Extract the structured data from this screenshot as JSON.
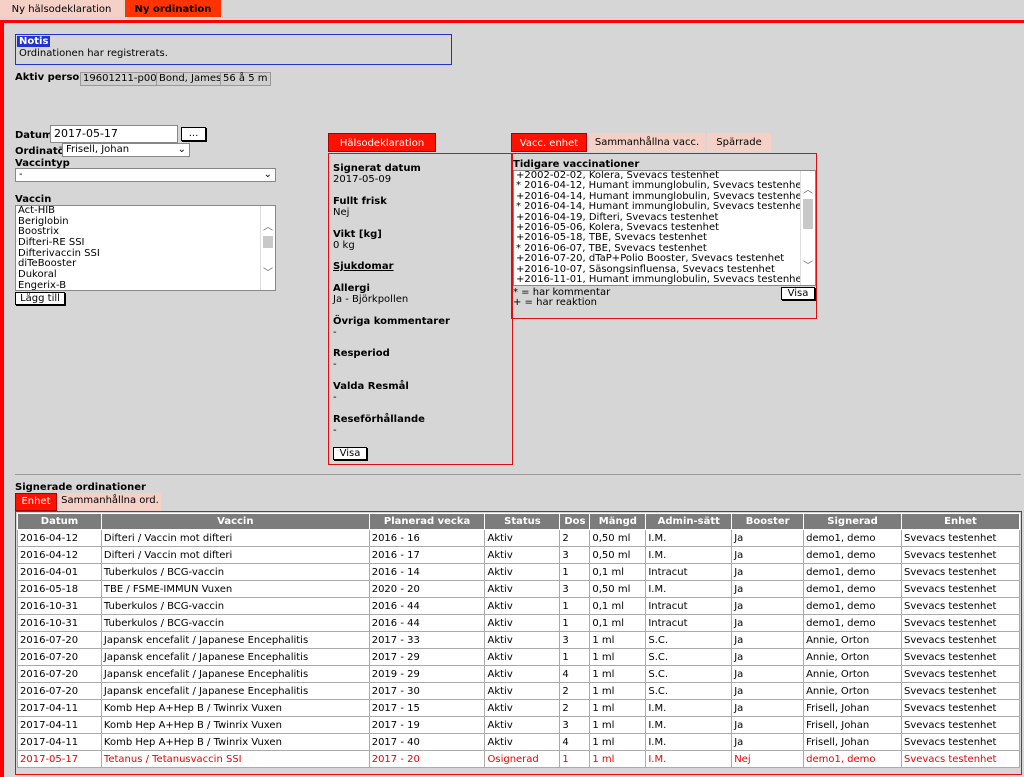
{
  "tabs": {
    "health": "Ny hälsodeklaration",
    "new_order": "Ny ordination"
  },
  "notice": {
    "title": "Notis",
    "message": "Ordinationen har registrerats."
  },
  "active_person": {
    "label": "Aktiv person",
    "id": "19601211-p007",
    "name": "Bond, James",
    "age": "56 å 5 m"
  },
  "form": {
    "date_label": "Datum",
    "date_value": "2017-05-17",
    "date_button": "...",
    "ordinator_label": "Ordinatör",
    "ordinator_value": "Frisell, Johan",
    "vaccintype_label": "Vaccintyp",
    "vaccintype_value": "-",
    "vaccin_label": "Vaccin",
    "vaccines": [
      "Act-HIB",
      "Beriglobin",
      "Boostrix",
      "Difteri-RE SSI",
      "Difterivaccin SSI",
      "diTeBooster",
      "Dukoral",
      "Engerix-B"
    ],
    "add_button": "Lägg till"
  },
  "health": {
    "tab_label": "Hälsodeklaration",
    "signed_label": "Signerat datum",
    "signed_value": "2017-05-09",
    "healthy_label": "Fullt frisk",
    "healthy_value": "Nej",
    "weight_label": "Vikt [kg]",
    "weight_value": "0 kg",
    "diseases_label": "Sjukdomar",
    "allergy_label": "Allergi",
    "allergy_value": "Ja - Björkpollen",
    "comments_label": "Övriga kommentarer",
    "comments_value": "-",
    "travel_period_label": "Resperiod",
    "travel_period_value": "-",
    "destinations_label": "Valda Resmål",
    "destinations_value": "-",
    "conditions_label": "Reseförhållande",
    "conditions_value": "-",
    "show_button": "Visa"
  },
  "vacc": {
    "tabs": [
      "Vacc. enhet",
      "Sammanhållna vacc.",
      "Spärrade"
    ],
    "previous_label": "Tidigare vaccinationer",
    "previous": [
      "+2002-02-02, Kolera, Svevacs testenhet",
      "* 2016-04-12, Humant immunglobulin, Svevacs testenhet",
      "+2016-04-14, Humant immunglobulin, Svevacs testenhet",
      "* 2016-04-14, Humant immunglobulin, Svevacs testenhet",
      "+2016-04-19, Difteri, Svevacs testenhet",
      "+2016-05-06, Kolera, Svevacs testenhet",
      "+2016-05-18, TBE, Svevacs testenhet",
      "* 2016-06-07, TBE, Svevacs testenhet",
      "+2016-07-20, dTaP+Polio Booster, Svevacs testenhet",
      "+2016-10-07, Säsongsinfluensa, Svevacs testenhet",
      "+2016-11-01, Humant immunglobulin, Svevacs testenhet"
    ],
    "legend_comment": "* = har kommentar",
    "legend_reaction": "+ = har reaktion",
    "show_button": "Visa"
  },
  "signed": {
    "title": "Signerade ordinationer",
    "tabs": [
      "Enhet",
      "Sammanhållna ord."
    ],
    "columns": [
      "Datum",
      "Vaccin",
      "Planerad vecka",
      "Status",
      "Dos",
      "Mängd",
      "Admin-sätt",
      "Booster",
      "Signerad",
      "Enhet"
    ],
    "rows": [
      [
        "2016-04-12",
        "Difteri / Vaccin mot difteri",
        "2016 - 16",
        "Aktiv",
        "2",
        "0,50 ml",
        "I.M.",
        "Ja",
        "demo1, demo",
        "Svevacs testenhet"
      ],
      [
        "2016-04-12",
        "Difteri / Vaccin mot difteri",
        "2016 - 17",
        "Aktiv",
        "3",
        "0,50 ml",
        "I.M.",
        "Ja",
        "demo1, demo",
        "Svevacs testenhet"
      ],
      [
        "2016-04-01",
        "Tuberkulos / BCG-vaccin",
        "2016 - 14",
        "Aktiv",
        "1",
        "0,1 ml",
        "Intracut",
        "Ja",
        "demo1, demo",
        "Svevacs testenhet"
      ],
      [
        "2016-05-18",
        "TBE / FSME-IMMUN Vuxen",
        "2020 - 20",
        "Aktiv",
        "3",
        "0,50 ml",
        "I.M.",
        "Ja",
        "demo1, demo",
        "Svevacs testenhet"
      ],
      [
        "2016-10-31",
        "Tuberkulos / BCG-vaccin",
        "2016 - 44",
        "Aktiv",
        "1",
        "0,1 ml",
        "Intracut",
        "Ja",
        "demo1, demo",
        "Svevacs testenhet"
      ],
      [
        "2016-10-31",
        "Tuberkulos / BCG-vaccin",
        "2016 - 44",
        "Aktiv",
        "1",
        "0,1 ml",
        "Intracut",
        "Ja",
        "demo1, demo",
        "Svevacs testenhet"
      ],
      [
        "2016-07-20",
        "Japansk encefalit / Japanese Encephalitis",
        "2017 - 33",
        "Aktiv",
        "3",
        "1 ml",
        "S.C.",
        "Ja",
        "Annie, Orton",
        "Svevacs testenhet"
      ],
      [
        "2016-07-20",
        "Japansk encefalit / Japanese Encephalitis",
        "2017 - 29",
        "Aktiv",
        "1",
        "1 ml",
        "S.C.",
        "Ja",
        "Annie, Orton",
        "Svevacs testenhet"
      ],
      [
        "2016-07-20",
        "Japansk encefalit / Japanese Encephalitis",
        "2019 - 29",
        "Aktiv",
        "4",
        "1 ml",
        "S.C.",
        "Ja",
        "Annie, Orton",
        "Svevacs testenhet"
      ],
      [
        "2016-07-20",
        "Japansk encefalit / Japanese Encephalitis",
        "2017 - 30",
        "Aktiv",
        "2",
        "1 ml",
        "S.C.",
        "Ja",
        "Annie, Orton",
        "Svevacs testenhet"
      ],
      [
        "2017-04-11",
        "Komb Hep A+Hep B / Twinrix Vuxen",
        "2017 - 15",
        "Aktiv",
        "2",
        "1 ml",
        "I.M.",
        "Ja",
        "Frisell, Johan",
        "Svevacs testenhet"
      ],
      [
        "2017-04-11",
        "Komb Hep A+Hep B / Twinrix Vuxen",
        "2017 - 19",
        "Aktiv",
        "3",
        "1 ml",
        "I.M.",
        "Ja",
        "Frisell, Johan",
        "Svevacs testenhet"
      ],
      [
        "2017-04-11",
        "Komb Hep A+Hep B / Twinrix Vuxen",
        "2017 - 40",
        "Aktiv",
        "4",
        "1 ml",
        "I.M.",
        "Ja",
        "Frisell, Johan",
        "Svevacs testenhet"
      ],
      [
        "2017-05-17",
        "Tetanus / Tetanusvaccin SSI",
        "2017 - 20",
        "Osignerad",
        "1",
        "1 ml",
        "I.M.",
        "Nej",
        "demo1, demo",
        "Svevacs testenhet"
      ]
    ],
    "unsigned_status": "Osignerad"
  },
  "colors": {
    "accent_red": "#ff1100",
    "tab_pink": "#f4d0c6",
    "notice_blue": "#2233cc",
    "header_gray": "#7c7c7c"
  }
}
